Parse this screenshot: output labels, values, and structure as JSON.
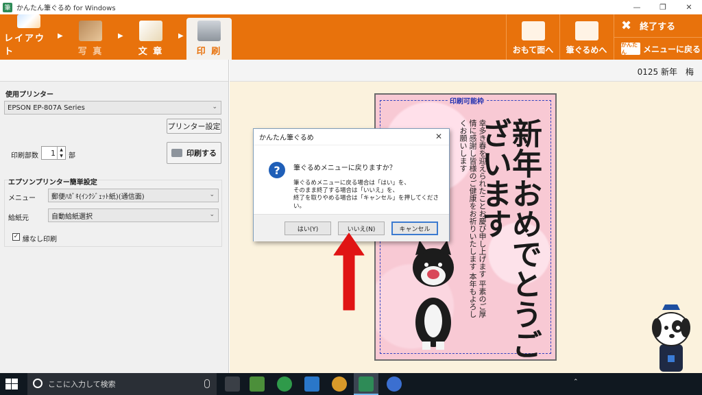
{
  "window": {
    "title": "かんたん筆ぐるめ for Windows",
    "app_icon_glyph": "筆"
  },
  "toolbar": {
    "tabs": [
      {
        "label": "レイアウト",
        "icon": "layout-icon"
      },
      {
        "label": "写 真",
        "icon": "photo-icon"
      },
      {
        "label": "文 章",
        "icon": "text-icon"
      },
      {
        "label": "印 刷",
        "icon": "printer-icon",
        "active": true
      }
    ],
    "omote_label": "おもて面へ",
    "fudegurume_label": "筆ぐるめへ",
    "exit_label": "終了する",
    "menu_back_label": "メニューに戻る",
    "menu_icon_text": "かんたん",
    "accent": "#e8720c"
  },
  "left": {
    "printer_heading": "使用プリンター",
    "printer_value": "EPSON EP-807A Series",
    "printer_settings_button": "プリンター設定",
    "copies_label": "印刷部数",
    "copies_value": "1",
    "copies_unit": "部",
    "print_button": "印刷する",
    "epson_heading": "エプソンプリンター簡単設定",
    "menu_label": "メニュー",
    "menu_value": "郵便ﾊｶﾞｷ(ｲﾝｸｼﾞｪｯﾄ紙)(通信面)",
    "feed_label": "給紙元",
    "feed_value": "自動給紙選択",
    "borderless_label": "縁なし印刷",
    "borderless_checked": true
  },
  "document": {
    "name": "0125 新年　梅"
  },
  "postcard": {
    "frame_label": "印刷可能枠",
    "big_text": "新年おめでとうございます",
    "small_text": "幸多き春を迎えられたことお慶び申し上げます 平素のご厚情に感謝し皆様のご健康をお祈りいたします 本年もよろしくお願いします"
  },
  "dialog": {
    "title": "かんたん筆ぐるめ",
    "question": "筆ぐるめメニューに戻りますか？",
    "line1": "筆ぐるめメニューに戻る場合は「はい」を、",
    "line2": "そのまま終了する場合は「いいえ」を、",
    "line3": "終了を取りやめる場合は「キャンセル」を押してください。",
    "yes": "はい(Y)",
    "no": "いいえ(N)",
    "cancel": "キャンセル"
  },
  "taskbar": {
    "search_placeholder": "ここに入力して検索"
  }
}
